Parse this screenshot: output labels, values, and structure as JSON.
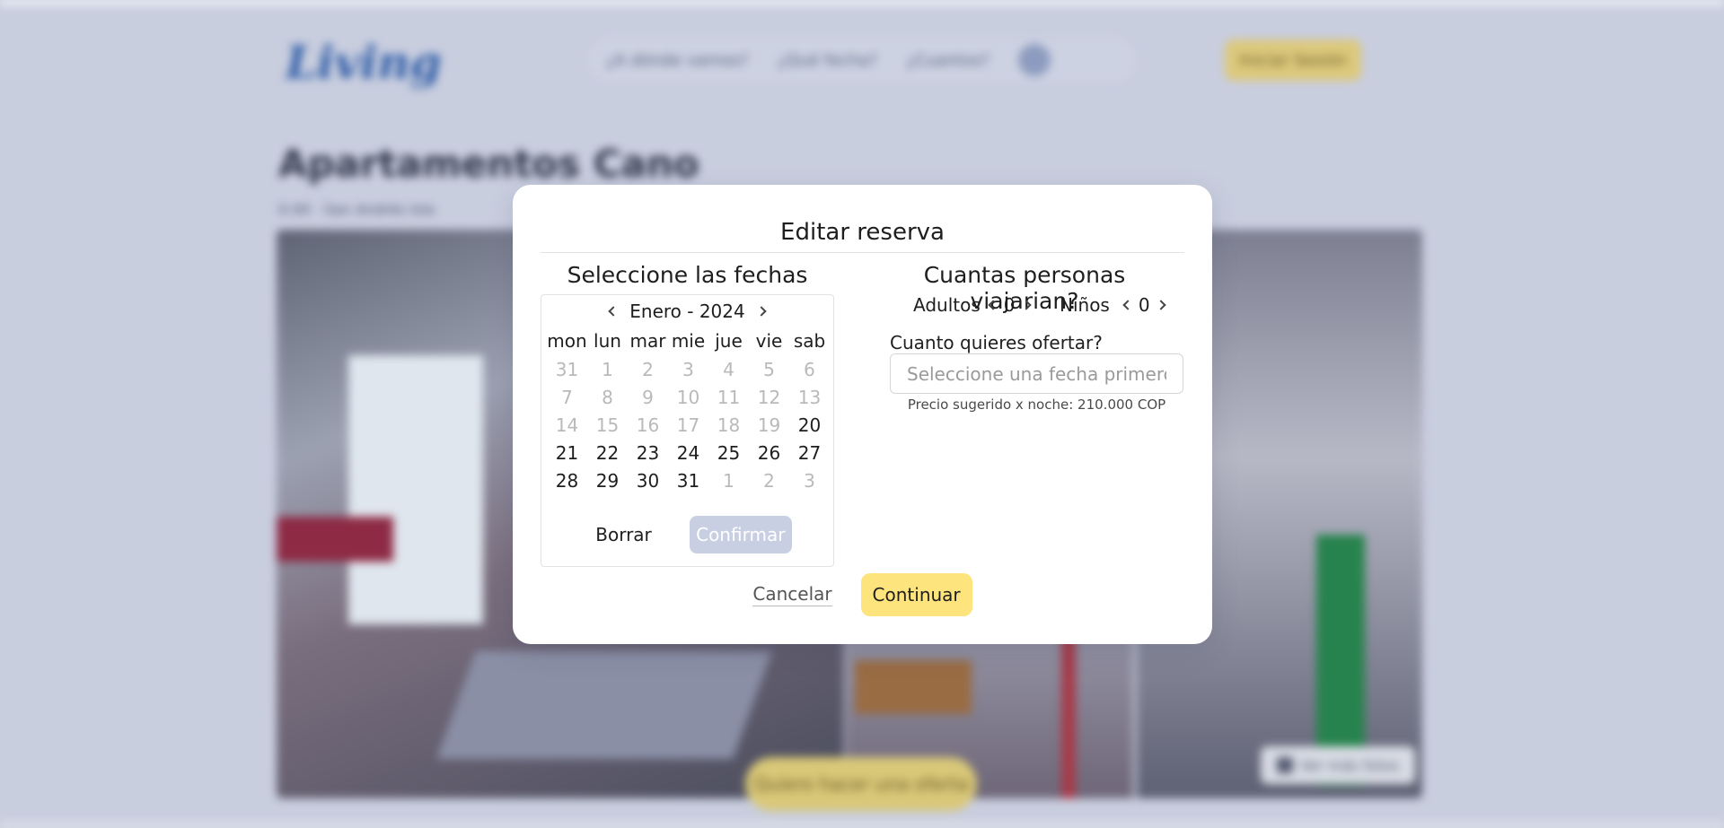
{
  "background": {
    "logo_text": "Living",
    "nav": {
      "item_1": "¿A dónde vamos?",
      "item_2": "¿Qué fecha?",
      "item_3": "¿Cuantos?"
    },
    "login_button": "Iniciar Sesión",
    "property_title": "Apartamentos Cano",
    "property_meta": "0.00 · San Andrés Isla",
    "view_photos_button": "Ver más fotos",
    "offer_button": "Quiero hacer una oferta"
  },
  "modal": {
    "title": "Editar reserva",
    "dates_section_title": "Seleccione las fechas",
    "calendar": {
      "month_year": "Enero - 2024",
      "weekdays": [
        "mon",
        "lun",
        "mar",
        "mie",
        "jue",
        "vie",
        "sab"
      ],
      "weeks": [
        [
          {
            "d": "31",
            "s": "disabled"
          },
          {
            "d": "1",
            "s": "disabled"
          },
          {
            "d": "2",
            "s": "disabled"
          },
          {
            "d": "3",
            "s": "disabled"
          },
          {
            "d": "4",
            "s": "disabled"
          },
          {
            "d": "5",
            "s": "disabled"
          },
          {
            "d": "6",
            "s": "disabled"
          }
        ],
        [
          {
            "d": "7",
            "s": "disabled"
          },
          {
            "d": "8",
            "s": "disabled"
          },
          {
            "d": "9",
            "s": "disabled"
          },
          {
            "d": "10",
            "s": "disabled"
          },
          {
            "d": "11",
            "s": "disabled"
          },
          {
            "d": "12",
            "s": "disabled"
          },
          {
            "d": "13",
            "s": "disabled"
          }
        ],
        [
          {
            "d": "14",
            "s": "disabled"
          },
          {
            "d": "15",
            "s": "disabled"
          },
          {
            "d": "16",
            "s": "disabled"
          },
          {
            "d": "17",
            "s": "disabled"
          },
          {
            "d": "18",
            "s": "disabled"
          },
          {
            "d": "19",
            "s": "disabled"
          },
          {
            "d": "20",
            "s": "active"
          }
        ],
        [
          {
            "d": "21",
            "s": "active"
          },
          {
            "d": "22",
            "s": "active"
          },
          {
            "d": "23",
            "s": "active"
          },
          {
            "d": "24",
            "s": "active"
          },
          {
            "d": "25",
            "s": "active"
          },
          {
            "d": "26",
            "s": "active"
          },
          {
            "d": "27",
            "s": "active"
          }
        ],
        [
          {
            "d": "28",
            "s": "active"
          },
          {
            "d": "29",
            "s": "active"
          },
          {
            "d": "30",
            "s": "active"
          },
          {
            "d": "31",
            "s": "active"
          },
          {
            "d": "1",
            "s": "disabled"
          },
          {
            "d": "2",
            "s": "disabled"
          },
          {
            "d": "3",
            "s": "disabled"
          }
        ]
      ],
      "clear_label": "Borrar",
      "confirm_label": "Confirmar"
    },
    "people_section_title": "Cuantas personas viajarian?",
    "adults": {
      "label": "Adultos",
      "value": "0"
    },
    "children": {
      "label": "Niños",
      "value": "0"
    },
    "offer": {
      "label": "Cuanto quieres ofertar?",
      "placeholder": "Seleccione una fecha primero",
      "value": "",
      "suggested_price": "Precio sugerido x noche: 210.000 COP"
    },
    "cancel_label": "Cancelar",
    "continue_label": "Continuar"
  },
  "colors": {
    "overlay": "#c9cedf",
    "accent_yellow": "#fde47c",
    "confirm_disabled": "#c9cfe3",
    "text_disabled": "#b9b9b9"
  }
}
